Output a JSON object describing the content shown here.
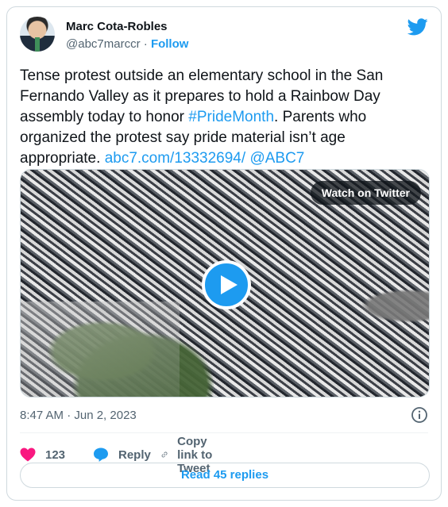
{
  "author": {
    "name": "Marc Cota-Robles",
    "handle": "@abc7marccr",
    "separator": "·",
    "follow_label": "Follow"
  },
  "tweet": {
    "text_intro": "Tense protest outside an elementary school in the San Fernando Valley as it prepares to hold a Rainbow Day assembly today to honor ",
    "hashtag": "#PrideMonth",
    "text_body": ". Parents who organized the protest say pride material isn’t age appropriate. ",
    "link": "abc7.com/13332694/",
    "mention": "@ABC7"
  },
  "media": {
    "watch_label": "Watch on Twitter",
    "play_icon": "play-icon"
  },
  "meta": {
    "timestamp": "8:47 AM · Jun 2, 2023",
    "info_icon": "info-icon"
  },
  "actions": {
    "like_count": "123",
    "reply_label": "Reply",
    "copy_label": "Copy link to Tweet"
  },
  "footer": {
    "read_replies_label": "Read 45 replies"
  },
  "colors": {
    "accent": "#1d9bf0",
    "like": "#f91880",
    "text": "#0f1419",
    "muted": "#536471"
  }
}
